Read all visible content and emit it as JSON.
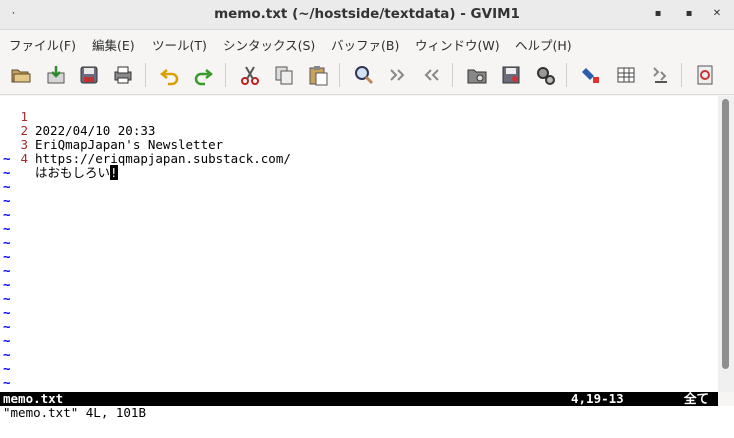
{
  "window": {
    "title": "memo.txt (~/hostside/textdata) - GVIM1",
    "menu_glyph": "⸱",
    "minimize": "▪",
    "maximize": "▪",
    "close": "✕"
  },
  "menubar": [
    "ファイル(F)",
    "編集(E)",
    "ツール(T)",
    "シンタックス(S)",
    "バッファ(B)",
    "ウィンドウ(W)",
    "ヘルプ(H)"
  ],
  "toolbar": [
    {
      "name": "open-icon"
    },
    {
      "name": "save-icon"
    },
    {
      "name": "save-all-icon"
    },
    {
      "name": "print-icon"
    },
    {
      "name": "undo-icon"
    },
    {
      "name": "redo-icon"
    },
    {
      "name": "cut-icon"
    },
    {
      "name": "copy-icon"
    },
    {
      "name": "paste-icon"
    },
    {
      "name": "find-replace-icon"
    },
    {
      "name": "find-next-icon"
    },
    {
      "name": "find-prev-icon"
    },
    {
      "name": "load-session-icon"
    },
    {
      "name": "save-session-icon"
    },
    {
      "name": "run-script-icon"
    },
    {
      "name": "make-icon"
    },
    {
      "name": "shell-icon"
    },
    {
      "name": "run-ctags-icon"
    },
    {
      "name": "help-icon"
    }
  ],
  "editor": {
    "lines": [
      {
        "num": "1",
        "text": "2022/04/10 20:33"
      },
      {
        "num": "2",
        "text": "EriQmapJapan's Newsletter"
      },
      {
        "num": "3",
        "text": "https://eriqmapjapan.substack.com/"
      },
      {
        "num": "4",
        "text": "はおもしろい",
        "cursor": "!"
      }
    ],
    "tilde": "~"
  },
  "statusline": {
    "filename": "memo.txt",
    "position": "4,19-13",
    "scroll": "全て"
  },
  "cmdline": "\"memo.txt\" 4L, 101B",
  "colors": {
    "line_number": "#a52a2a",
    "tilde": "#0000ff",
    "status_bg": "#000000"
  }
}
